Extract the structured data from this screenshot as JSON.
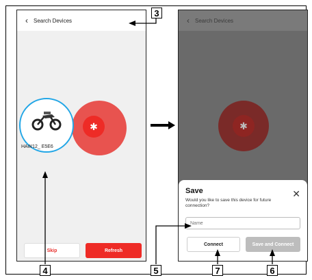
{
  "left_screen": {
    "back_icon": "chevron-left-icon",
    "title": "Search Devices",
    "device_name": "HAW12_ E5E6",
    "skip_label": "Skip",
    "refresh_label": "Refresh"
  },
  "right_screen": {
    "back_icon": "chevron-left-icon",
    "title": "Search Devices",
    "dialog": {
      "title": "Save",
      "message": "Would you like to save this device for future connection?",
      "name_placeholder": "Name",
      "connect_label": "Connect",
      "save_connect_label": "Save and Connect",
      "close_icon": "close-icon"
    }
  },
  "callouts": [
    "3",
    "4",
    "5",
    "7",
    "6"
  ],
  "colors": {
    "accent_red": "#e8322f",
    "device_ring": "#22a6e6",
    "overlay": "#6a6a6a"
  }
}
